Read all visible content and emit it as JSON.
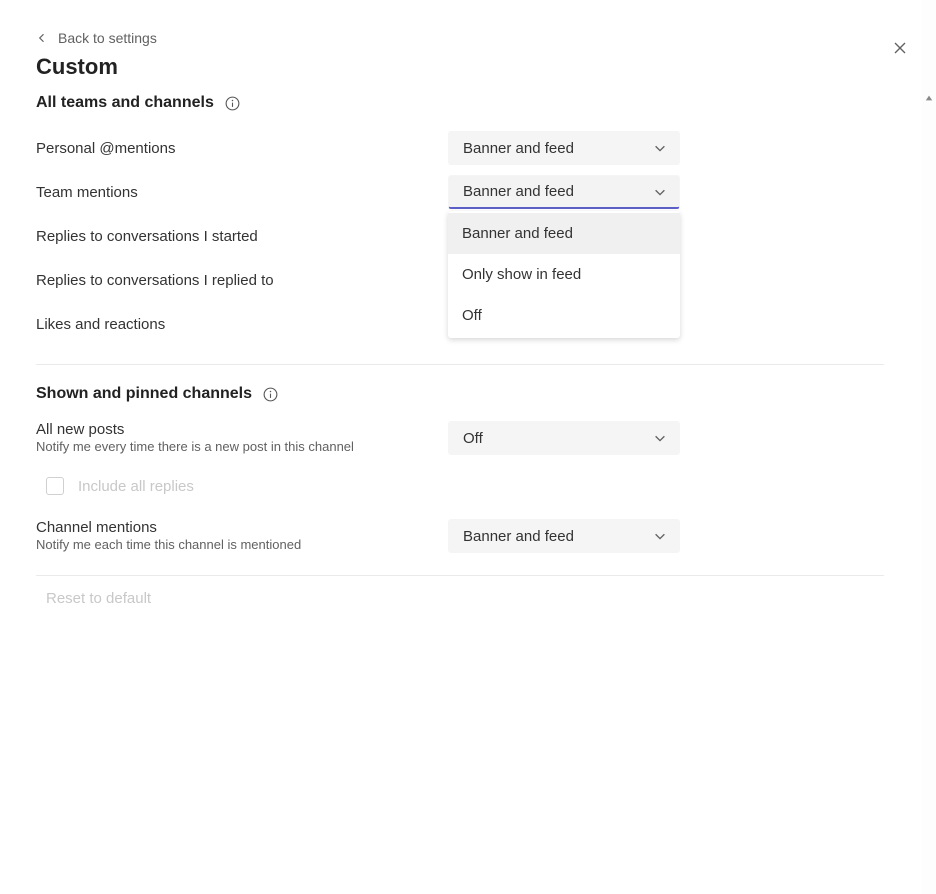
{
  "back_link": "Back to settings",
  "page_title": "Custom",
  "section1": {
    "title": "All teams and channels",
    "rows": {
      "personal_mentions": {
        "label": "Personal @mentions",
        "value": "Banner and feed"
      },
      "team_mentions": {
        "label": "Team mentions",
        "value": "Banner and feed"
      },
      "replies_started": {
        "label": "Replies to conversations I started"
      },
      "replies_replied": {
        "label": "Replies to conversations I replied to"
      },
      "likes_reactions": {
        "label": "Likes and reactions"
      }
    },
    "team_mentions_options": [
      "Banner and feed",
      "Only show in feed",
      "Off"
    ]
  },
  "section2": {
    "title": "Shown and pinned channels",
    "all_new_posts": {
      "label": "All new posts",
      "desc": "Notify me every time there is a new post in this channel",
      "value": "Off"
    },
    "include_replies": {
      "label": "Include all replies"
    },
    "channel_mentions": {
      "label": "Channel mentions",
      "desc": "Notify me each time this channel is mentioned",
      "value": "Banner and feed"
    }
  },
  "reset_label": "Reset to default"
}
